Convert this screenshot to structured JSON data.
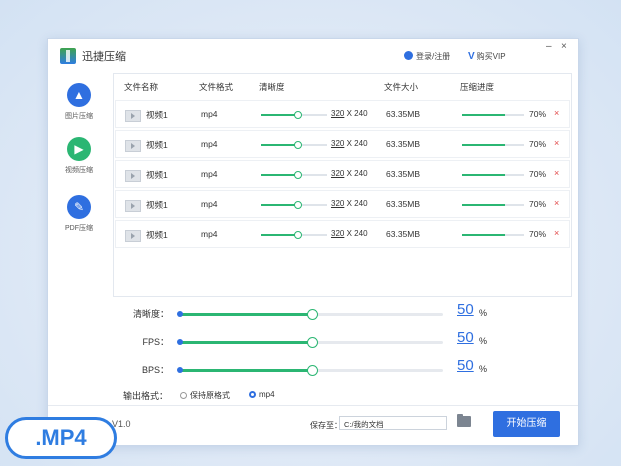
{
  "app": {
    "title": "迅捷压缩",
    "login": "登录/注册",
    "vip": "购买VIP",
    "minimize": "–",
    "close": "×"
  },
  "sidebar": {
    "items": [
      {
        "label": "图片压缩",
        "icon": "image-icon"
      },
      {
        "label": "视频压缩",
        "icon": "play-icon"
      },
      {
        "label": "PDF压缩",
        "icon": "pdf-icon"
      }
    ]
  },
  "table": {
    "headers": [
      "文件名称",
      "文件格式",
      "清晰度",
      "文件大小",
      "压缩进度"
    ],
    "rows": [
      {
        "name": "视频1",
        "format": "mp4",
        "res_w": "320",
        "res_sep": "X",
        "res_h": "240",
        "size": "63.35MB",
        "progress": "70%",
        "progress_value": 0.7
      },
      {
        "name": "视频1",
        "format": "mp4",
        "res_w": "320",
        "res_sep": "X",
        "res_h": "240",
        "size": "63.35MB",
        "progress": "70%",
        "progress_value": 0.7
      },
      {
        "name": "视频1",
        "format": "mp4",
        "res_w": "320",
        "res_sep": "X",
        "res_h": "240",
        "size": "63.35MB",
        "progress": "70%",
        "progress_value": 0.7
      },
      {
        "name": "视频1",
        "format": "mp4",
        "res_w": "320",
        "res_sep": "X",
        "res_h": "240",
        "size": "63.35MB",
        "progress": "70%",
        "progress_value": 0.7
      },
      {
        "name": "视频1",
        "format": "mp4",
        "res_w": "320",
        "res_sep": "X",
        "res_h": "240",
        "size": "63.35MB",
        "progress": "70%",
        "progress_value": 0.7
      }
    ],
    "delete_glyph": "×"
  },
  "settings": {
    "clarity": {
      "label": "清晰度：",
      "value": "50",
      "unit": "%",
      "level": 0.5
    },
    "fps": {
      "label": "FPS：",
      "value": "50",
      "unit": "%",
      "level": 0.5
    },
    "bps": {
      "label": "BPS：",
      "value": "50",
      "unit": "%",
      "level": 0.5
    },
    "format": {
      "label": "输出格式：",
      "options": [
        "保持原格式",
        "mp4"
      ],
      "selected": "mp4"
    }
  },
  "footer": {
    "version": "V1.0",
    "save_label": "保存至：",
    "save_path": "C:/我的文档",
    "start_button": "开始压缩"
  },
  "badge": {
    "text": ".MP4"
  },
  "colors": {
    "accent": "#2f6fe0",
    "progress": "#2bb673",
    "delete": "#e24a4a"
  }
}
